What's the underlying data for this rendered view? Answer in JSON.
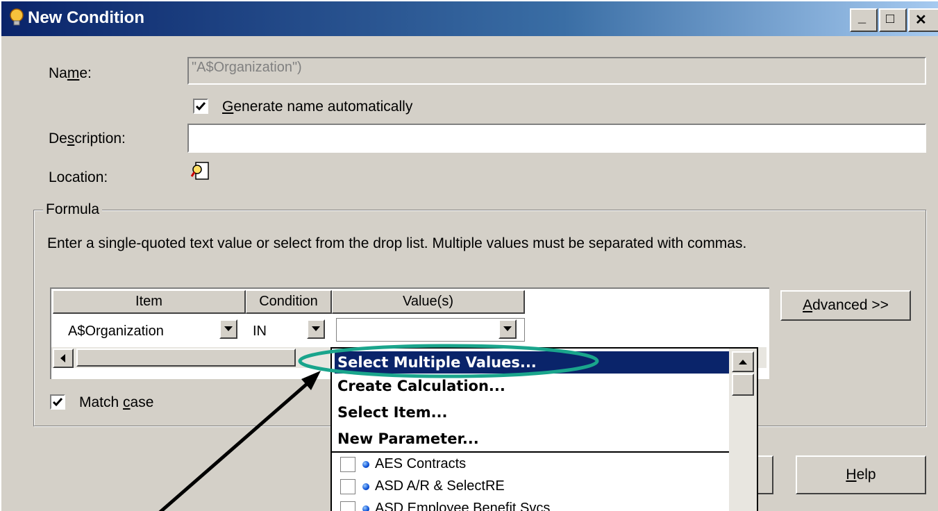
{
  "window": {
    "title": "New Condition",
    "minimize_glyph": "_",
    "maximize_glyph": "□",
    "close_glyph": "✕"
  },
  "form": {
    "name_label_pre": "Na",
    "name_label_ul": "m",
    "name_label_post": "e:",
    "name_value": "\"A$Organization\")",
    "generate_pre": "",
    "generate_ul": "G",
    "generate_post": "enerate name automatically",
    "generate_checked": true,
    "description_label_pre": "De",
    "description_label_ul": "s",
    "description_label_post": "cription:",
    "description_value": "",
    "location_label": "Location:"
  },
  "formula": {
    "legend": "Formula",
    "instruction": "Enter a single-quoted text value or select from the drop list.  Multiple values must be separated with commas.",
    "columns": [
      "Item",
      "Condition",
      "Value(s)"
    ],
    "row": {
      "item": "A$Organization",
      "condition": "IN",
      "value": ""
    },
    "match_pre": "Match ",
    "match_ul": "c",
    "match_post": "ase",
    "match_checked": true
  },
  "buttons": {
    "advanced_ul": "A",
    "advanced_post": "dvanced >>",
    "help_ul": "H",
    "help_post": "elp"
  },
  "dropdown": {
    "options": [
      "Select Multiple Values...",
      "Create Calculation...",
      "Select Item...",
      "New Parameter..."
    ],
    "values": [
      "AES Contracts",
      "ASD A/R & SelectRE",
      "ASD Employee Benefit Svcs"
    ]
  },
  "icons": {
    "title": "lightbulb-icon",
    "location": "location-browse-icon"
  },
  "colors": {
    "titlebar": "#0a246a",
    "highlight": "#0a246a",
    "annotation": "#1aa58c"
  }
}
